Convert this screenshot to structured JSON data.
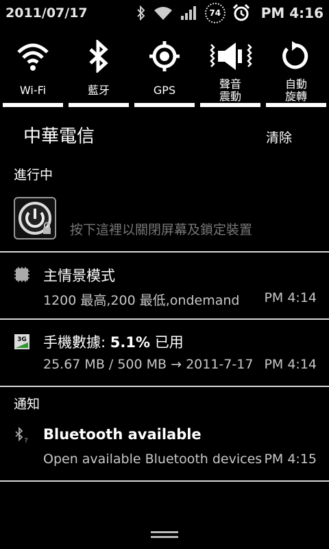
{
  "status_bar": {
    "date": "2011/07/17",
    "battery_level": "74",
    "time": "PM 4:16"
  },
  "toggles": [
    {
      "label": "Wi-Fi",
      "icon": "wifi-icon"
    },
    {
      "label": "藍牙",
      "icon": "bluetooth-icon"
    },
    {
      "label": "GPS",
      "icon": "gps-icon"
    },
    {
      "label": "聲音\n震動",
      "icon": "sound-vibrate-icon"
    },
    {
      "label": "自動\n旋轉",
      "icon": "auto-rotate-icon"
    }
  ],
  "header": {
    "carrier": "中華電信",
    "clear_label": "清除"
  },
  "ongoing": {
    "title": "進行中",
    "power_hint": "按下這裡以關閉屏幕及鎖定裝置"
  },
  "notifications_ongoing": [
    {
      "title": "主情景模式",
      "subtitle": "1200 最高,200 最低,ondemand",
      "time": "PM 4:14",
      "icon": "cpu-icon"
    },
    {
      "title_prefix": "手機數據: ",
      "title_bold": "5.1%",
      "title_suffix": " 已用",
      "subtitle": "25.67 MB / 500 MB → 2011-7-17",
      "time": "PM 4:14",
      "icon": "3g-data-icon"
    }
  ],
  "notifications": {
    "title": "通知",
    "items": [
      {
        "title": "Bluetooth available",
        "subtitle": "Open available Bluetooth devices",
        "time": "PM 4:15",
        "icon": "bluetooth-search-icon"
      }
    ]
  },
  "colors": {
    "background": "#000000",
    "toggle_active": "#ffffff",
    "divider": "#d8d8d8",
    "secondary_text": "#c8c8c8"
  }
}
